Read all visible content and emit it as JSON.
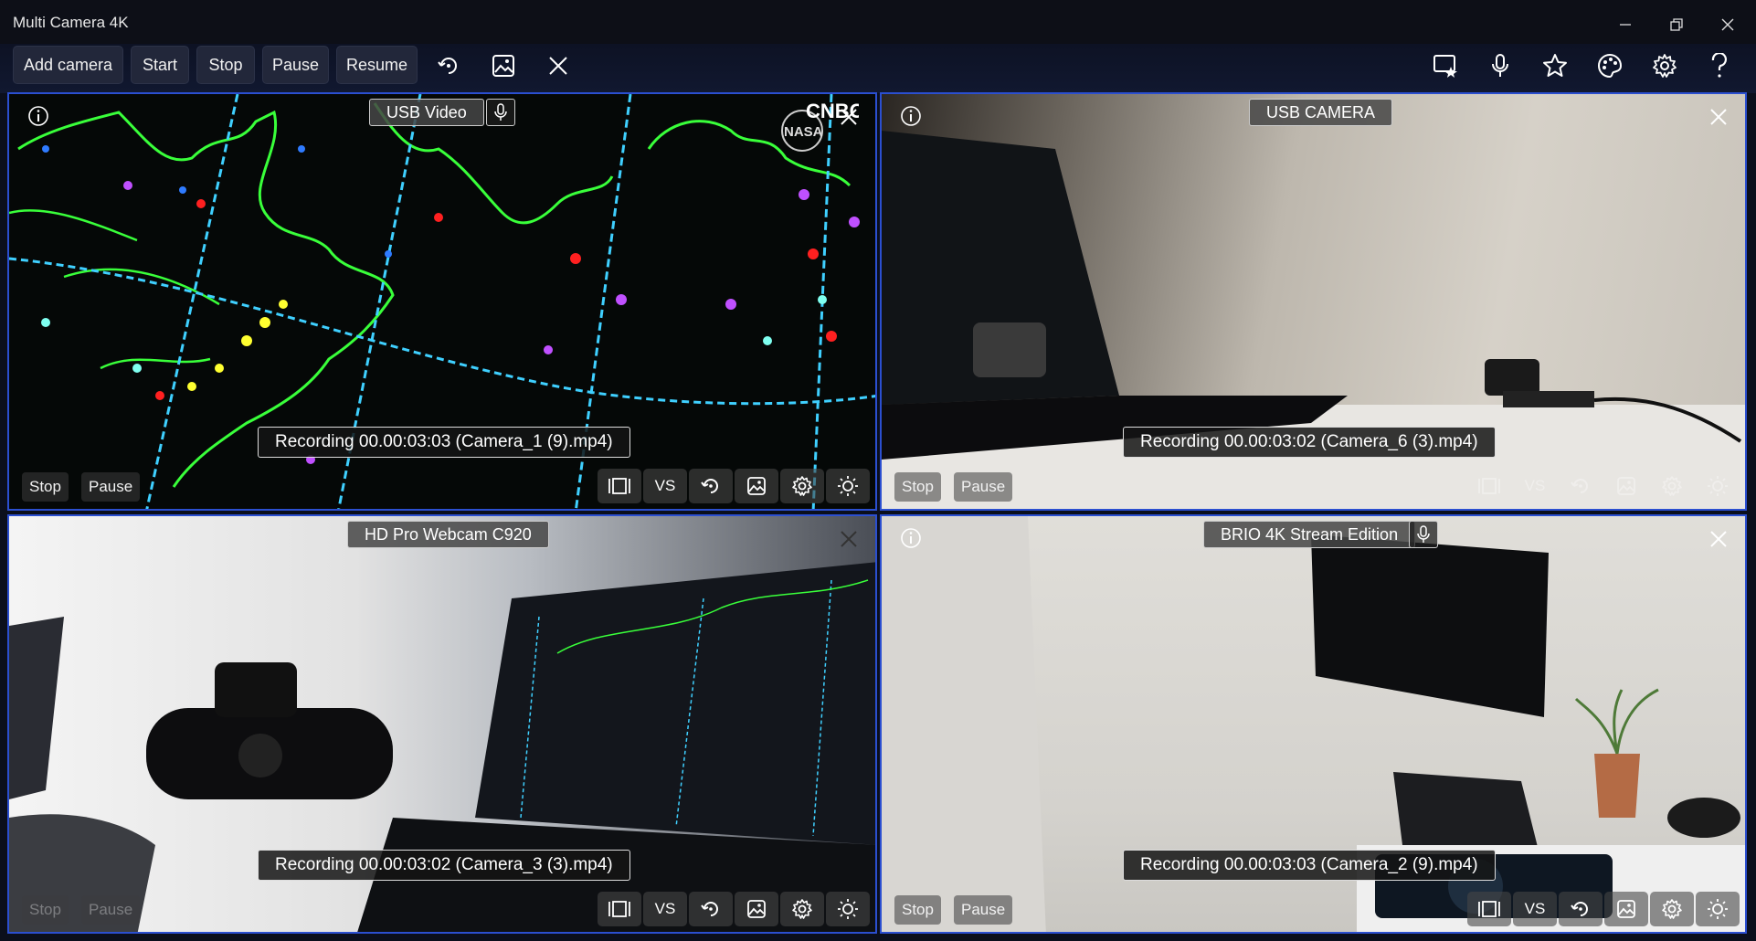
{
  "app": {
    "title": "Multi Camera 4K"
  },
  "toolbar": {
    "add_camera": "Add camera",
    "start": "Start",
    "stop": "Stop",
    "pause": "Pause",
    "resume": "Resume"
  },
  "tile_controls": {
    "stop": "Stop",
    "pause": "Pause",
    "vs": "VS"
  },
  "cameras": [
    {
      "name": "USB Video",
      "recording": "Recording 00.00:03:03 (Camera_1 (9).mp4)",
      "watermark": "CNBC NASA"
    },
    {
      "name": "USB CAMERA",
      "recording": "Recording 00.00:03:02 (Camera_6 (3).mp4)"
    },
    {
      "name": "HD Pro Webcam C920",
      "recording": "Recording 00.00:03:02 (Camera_3 (3).mp4)"
    },
    {
      "name": "BRIO 4K Stream Edition",
      "recording": "Recording 00.00:03:03 (Camera_2 (9).mp4)"
    }
  ],
  "colors": {
    "tile_border": "#2b4fd0",
    "toolbar_bg": "#111830",
    "radar_green": "#39ff3a",
    "radar_cyan": "#3fd0ff"
  }
}
